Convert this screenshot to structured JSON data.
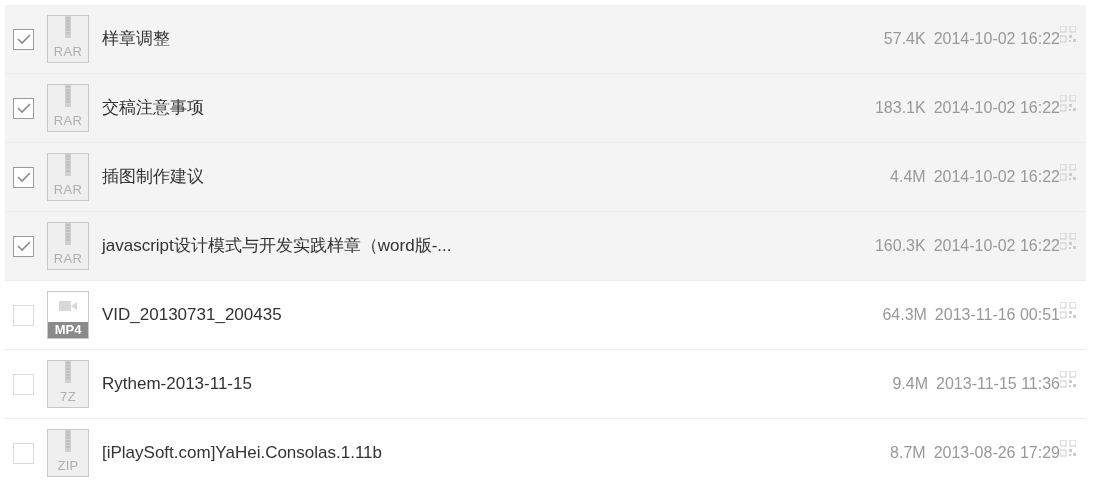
{
  "files": [
    {
      "name": "样章调整",
      "kind": "archive",
      "type_label": "RAR",
      "size": "57.4K",
      "date": "2014-10-02 16:22",
      "checked": true
    },
    {
      "name": "交稿注意事项",
      "kind": "archive",
      "type_label": "RAR",
      "size": "183.1K",
      "date": "2014-10-02 16:22",
      "checked": true
    },
    {
      "name": "插图制作建议",
      "kind": "archive",
      "type_label": "RAR",
      "size": "4.4M",
      "date": "2014-10-02 16:22",
      "checked": true
    },
    {
      "name": "javascript设计模式与开发实践样章（word版-...",
      "kind": "archive",
      "type_label": "RAR",
      "size": "160.3K",
      "date": "2014-10-02 16:22",
      "checked": true
    },
    {
      "name": "VID_20130731_200435",
      "kind": "video",
      "type_label": "MP4",
      "size": "64.3M",
      "date": "2013-11-16 00:51",
      "checked": false
    },
    {
      "name": "Rythem-2013-11-15",
      "kind": "archive",
      "type_label": "7Z",
      "size": "9.4M",
      "date": "2013-11-15 11:36",
      "checked": false
    },
    {
      "name": "[iPlaySoft.com]YaHei.Consolas.1.11b",
      "kind": "archive",
      "type_label": "ZIP",
      "size": "8.7M",
      "date": "2013-08-26 17:29",
      "checked": false
    }
  ]
}
